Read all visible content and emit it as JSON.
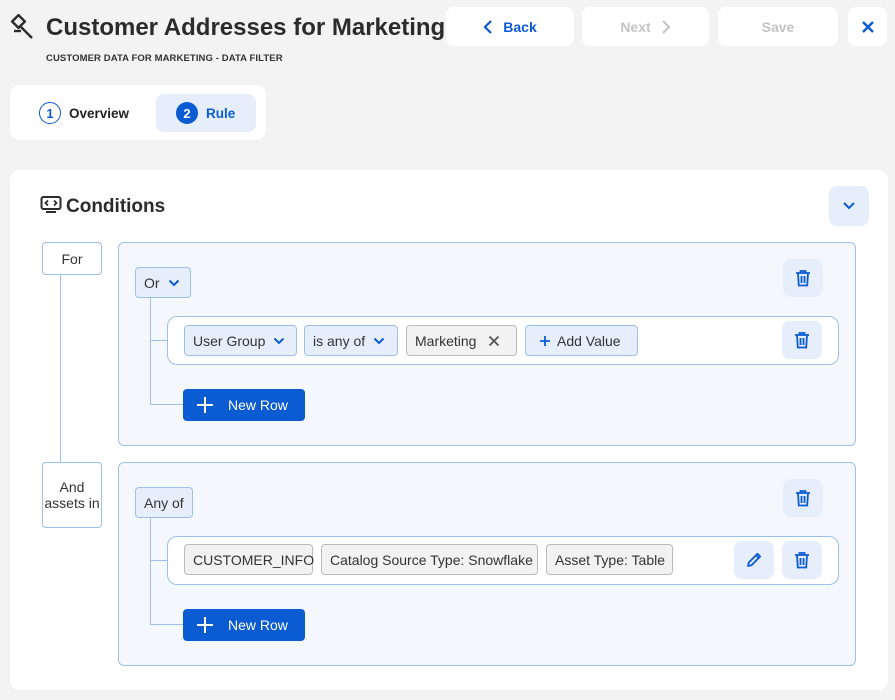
{
  "header": {
    "title": "Customer Addresses for Marketing",
    "subtitle": "CUSTOMER DATA FOR MARKETING - DATA FILTER",
    "back_label": "Back",
    "next_label": "Next",
    "save_label": "Save"
  },
  "steps": [
    {
      "number": "1",
      "label": "Overview"
    },
    {
      "number": "2",
      "label": "Rule"
    }
  ],
  "conditions": {
    "title": "Conditions",
    "for_label": "For",
    "assets_label": "And assets in",
    "block1": {
      "operator": "Or",
      "row": {
        "field": "User Group",
        "comparator": "is any of",
        "value_chip": "Marketing",
        "add_value_label": "Add Value"
      },
      "new_row_label": "New Row"
    },
    "block2": {
      "operator": "Any of",
      "chips": [
        "CUSTOMER_INFO",
        "Catalog Source Type: Snowflake",
        "Asset Type: Table"
      ],
      "new_row_label": "New Row"
    }
  },
  "colors": {
    "accent": "#0b5bd3",
    "accent_light": "#e6eefb",
    "border": "#9cc0ea",
    "disabled": "#c4c4c4"
  }
}
